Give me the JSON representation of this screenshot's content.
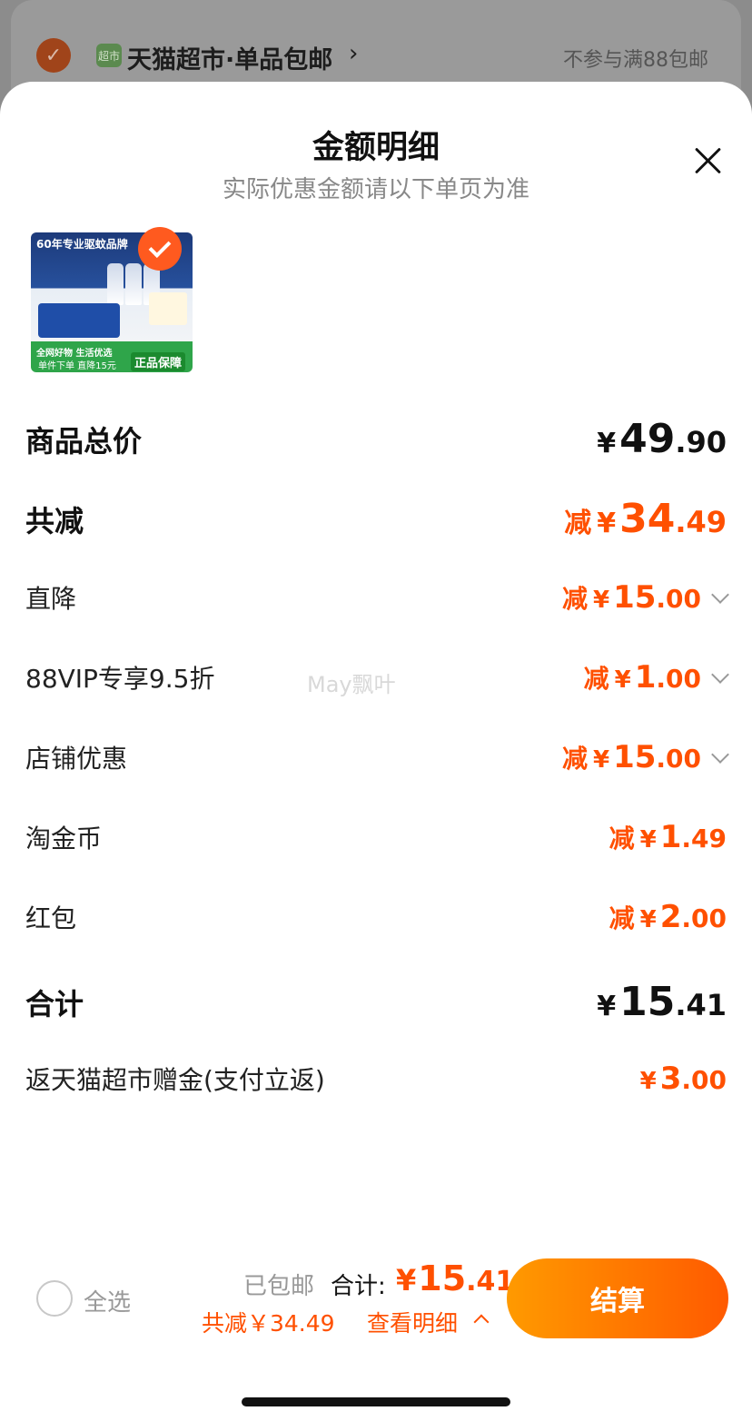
{
  "background_header": {
    "store_icon_text": "超市",
    "store_name": "天猫超市·单品包邮",
    "note": "不参与满88包邮"
  },
  "sheet": {
    "title": "金额明细",
    "subtitle": "实际优惠金额请以下单页为准"
  },
  "product_thumb": {
    "banner": "60年专业驱蚊品牌",
    "line1": "全网好物 生活优选",
    "line2": "单件下单 直降15元",
    "badge": "正品保障"
  },
  "rows": {
    "subtotal": {
      "label": "商品总价",
      "yen": "¥",
      "int": "49",
      "dec": ".90"
    },
    "total_discount": {
      "label": "共减",
      "prefix": "减",
      "yen": "¥",
      "int": "34",
      "dec": ".49"
    },
    "direct": {
      "label": "直降",
      "prefix": "减",
      "yen": "¥",
      "int": "15",
      "dec": ".00"
    },
    "vip": {
      "label": "88VIP专享9.5折",
      "prefix": "减",
      "yen": "¥",
      "int": "1",
      "dec": ".00"
    },
    "store": {
      "label": "店铺优惠",
      "prefix": "减",
      "yen": "¥",
      "int": "15",
      "dec": ".00"
    },
    "coins": {
      "label": "淘金币",
      "prefix": "减",
      "yen": "¥",
      "int": "1",
      "dec": ".49"
    },
    "redpacket": {
      "label": "红包",
      "prefix": "减",
      "yen": "¥",
      "int": "2",
      "dec": ".00"
    },
    "total": {
      "label": "合计",
      "yen": "¥",
      "int": "15",
      "dec": ".41"
    },
    "rebate": {
      "label": "返天猫超市赠金(支付立返)",
      "yen": "¥",
      "int": "3",
      "dec": ".00"
    }
  },
  "watermark": "May飘叶",
  "bottom_bar": {
    "select_all": "全选",
    "shipping": "已包邮",
    "total_label": "合计:",
    "total_yen": "¥",
    "total_int": "15",
    "total_dec": ".41",
    "saved": "共减￥34.49",
    "detail_link": "查看明细",
    "checkout": "结算"
  },
  "colors": {
    "accent": "#ff5000",
    "checkout_start": "#ff9a00",
    "checkout_end": "#ff5a00"
  }
}
